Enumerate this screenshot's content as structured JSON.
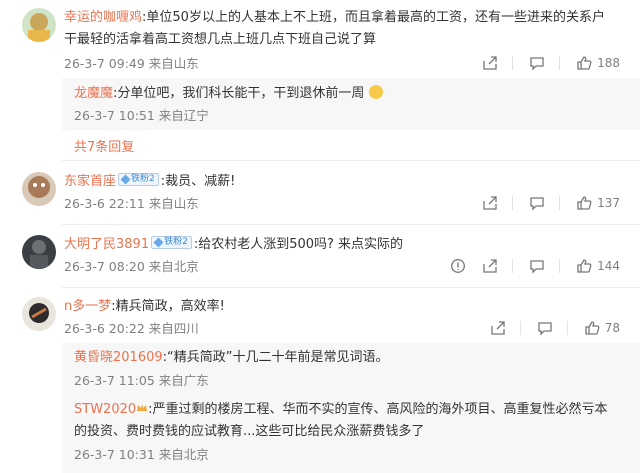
{
  "comments": [
    {
      "user": "幸运的咖喱鸡",
      "text_line1": ":单位50岁以上的人基本上不上班，而且拿着最高的工资，还有一些进来的关系户",
      "text_line2": "干最轻的活拿着高工资想几点上班几点下班自己说了算",
      "meta": "26-3-7 09:49 来自山东",
      "likes": "188",
      "replies": [
        {
          "user": "龙魔魔",
          "text": ":分单位吧，我们科长能干，干到退休前一周",
          "meta": "26-3-7 10:51 来自辽宁"
        }
      ],
      "more_replies": "共7条回复"
    },
    {
      "user": "东家首座",
      "badge": "铁粉2",
      "text": ":裁员、减薪!",
      "meta": "26-3-6 22:11 来自山东",
      "likes": "137"
    },
    {
      "user": "大明了民3891",
      "badge": "铁粉2",
      "text": ":给农村老人涨到500吗? 来点实际的",
      "meta": "26-3-7 08:20 来自北京",
      "likes": "144"
    },
    {
      "user": "n多一梦",
      "text": ":精兵简政，高效率!",
      "meta": "26-3-6 20:22 来自四川",
      "likes": "78",
      "replies": [
        {
          "user": "黄昏晓201609",
          "text": ":“精兵简政”十几二十年前是常见词语。",
          "meta": "26-3-7 11:05 来自广东"
        },
        {
          "user": "STW2020",
          "text_line1": ":严重过剩的楼房工程、华而不实的宣传、高风险的海外项目、高重复性必然亏本",
          "text_line2": "的投资、费时费钱的应试教育...这些可比给民众涨薪费钱多了",
          "meta": "26-3-7 10:31 来自北京"
        }
      ]
    }
  ],
  "colors": {
    "username": "#eb7350",
    "meta": "#808080",
    "reply_bg": "#f7f7f7"
  }
}
